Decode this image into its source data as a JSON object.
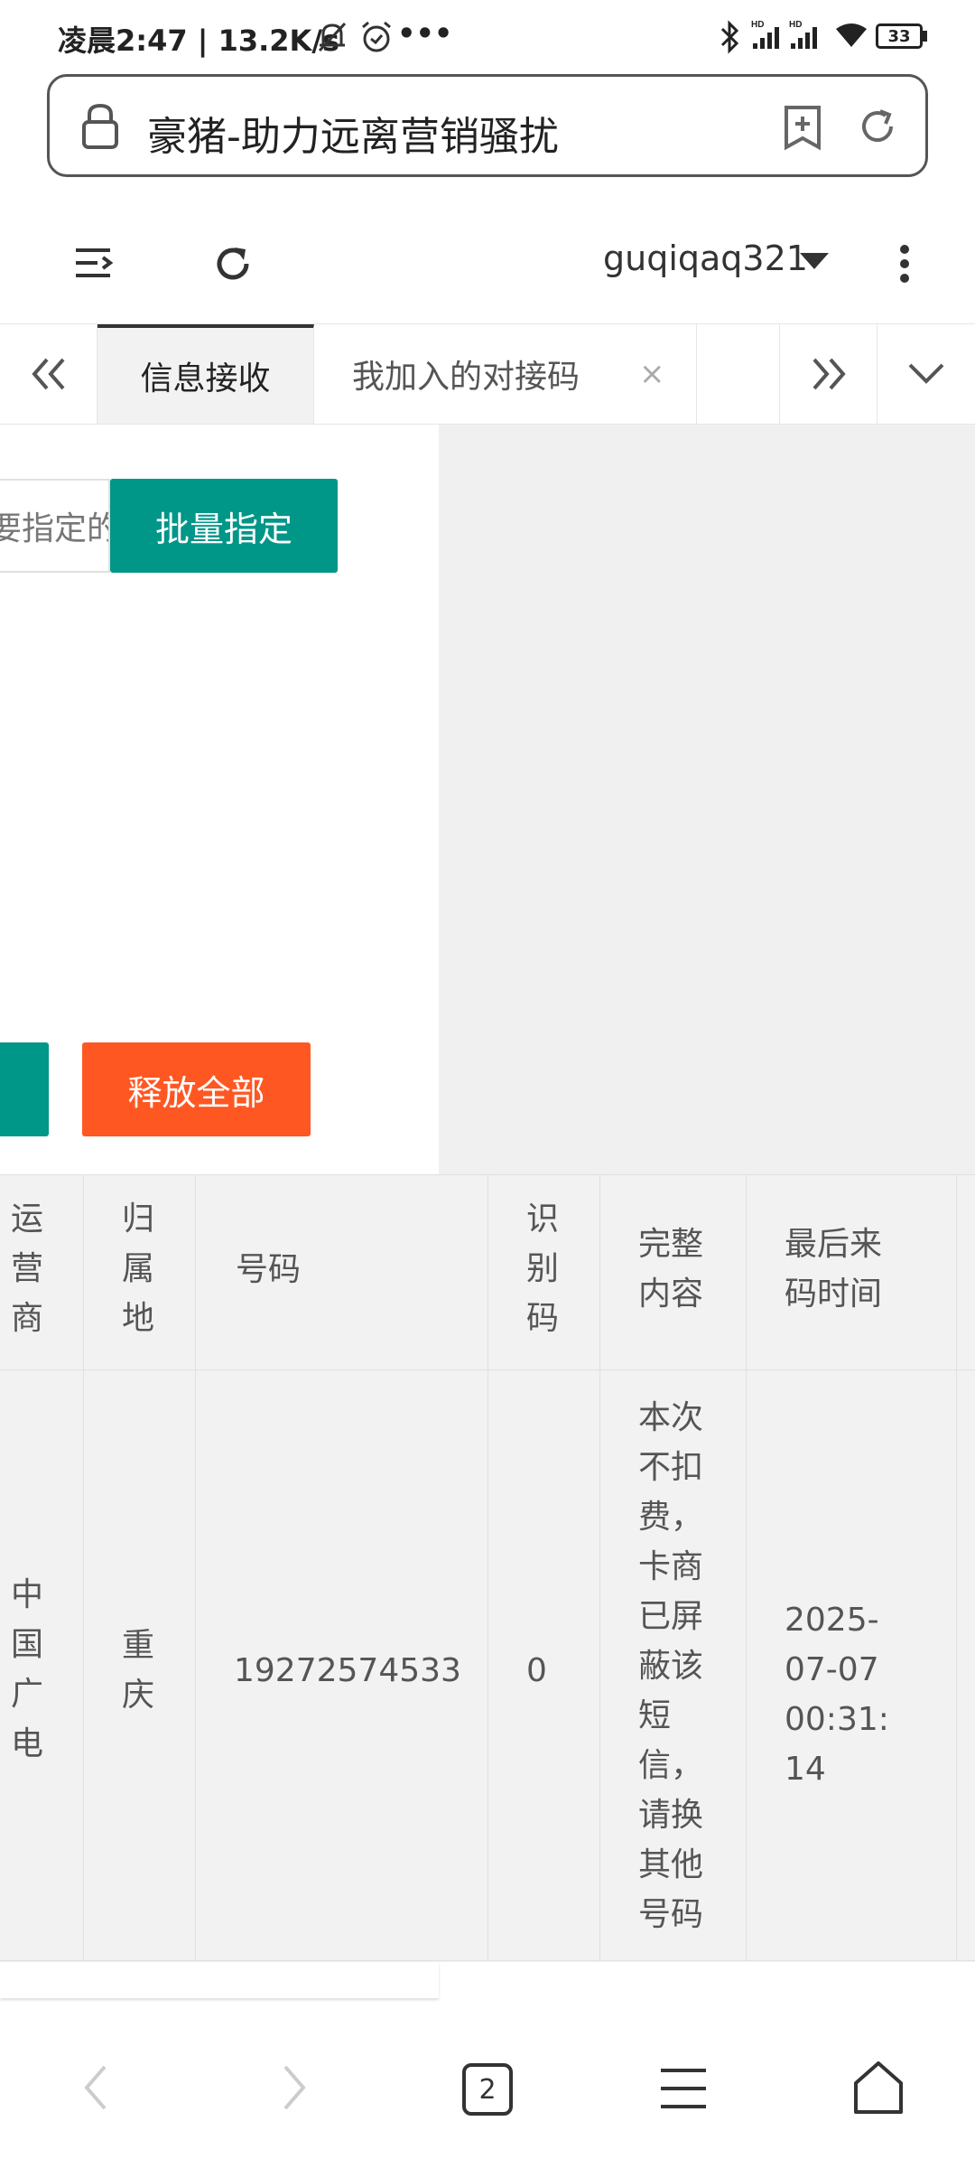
{
  "status_bar": {
    "left_text": "凌晨2:47 | 13.2K/s",
    "battery": "33"
  },
  "url_bar": {
    "title": "豪猪-助力远离营销骚扰"
  },
  "toolbar": {
    "username": "guqiqaq321"
  },
  "tabs": [
    {
      "label": "信息接收",
      "active": true
    },
    {
      "label": "我加入的对接码",
      "active": false
    }
  ],
  "left_panel": {
    "input_placeholder": "要指定的",
    "batch_assign_label": "批量指定",
    "release_all_label": "释放全部"
  },
  "table": {
    "columns": [
      "运营商",
      "归属地",
      "号码",
      "识别码",
      "完整内容",
      "最后来码时间"
    ],
    "rows": [
      {
        "carrier": "中国广电",
        "location": "重庆",
        "number": "19272574533",
        "code": "0",
        "content": "本次不扣费，卡商已屏蔽该短信，请换其他号码",
        "last_time": "2025-07-07 00:31:14"
      }
    ]
  },
  "bottom_nav": {
    "tab_count": "2"
  },
  "colors": {
    "primary_green": "#009688",
    "orange": "#ff5722"
  }
}
